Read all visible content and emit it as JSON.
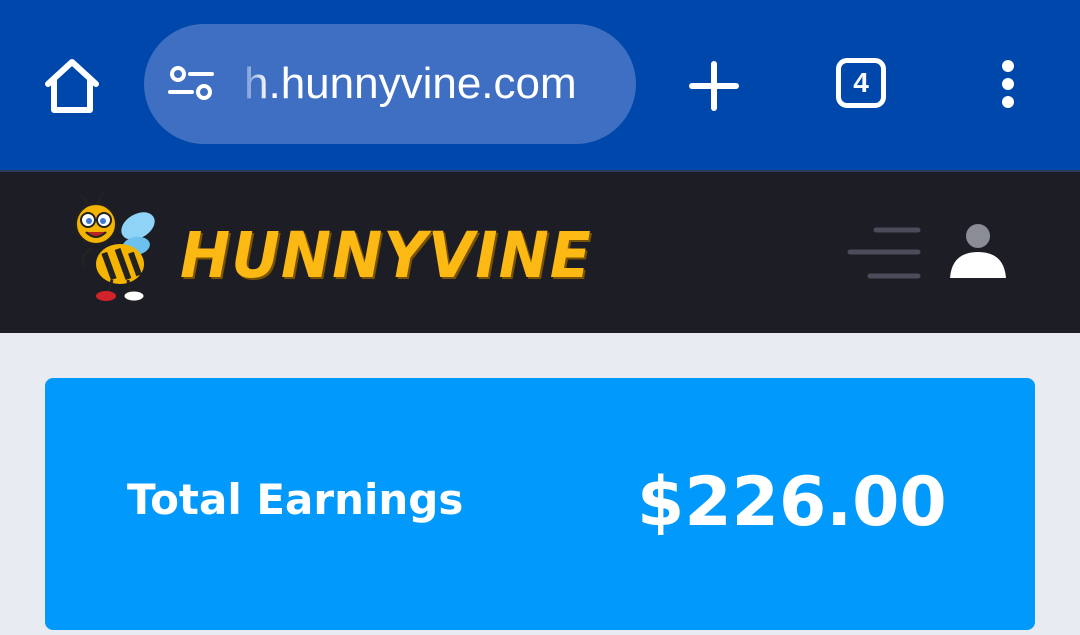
{
  "browser": {
    "url": "h.hunnyvine.com",
    "tab_count": "4",
    "icons": {
      "home": "home-icon",
      "site_settings": "site-settings-icon",
      "new_tab": "plus-icon",
      "tabs": "tab-switcher-icon",
      "menu": "more-vertical-icon"
    },
    "colors": {
      "toolbar": "#0047ab",
      "url_pill": "#3f6fc2"
    }
  },
  "site": {
    "brand": "HUNNYVINE",
    "logo_icon": "bee-mascot-icon",
    "menu_icon": "hamburger-menu-icon",
    "account_icon": "user-icon",
    "colors": {
      "header": "#1d1d25",
      "brand": "#fcb813"
    }
  },
  "earnings": {
    "label": "Total Earnings",
    "value": "$226.00",
    "colors": {
      "card": "#0299fd",
      "text": "#ffffff"
    }
  }
}
